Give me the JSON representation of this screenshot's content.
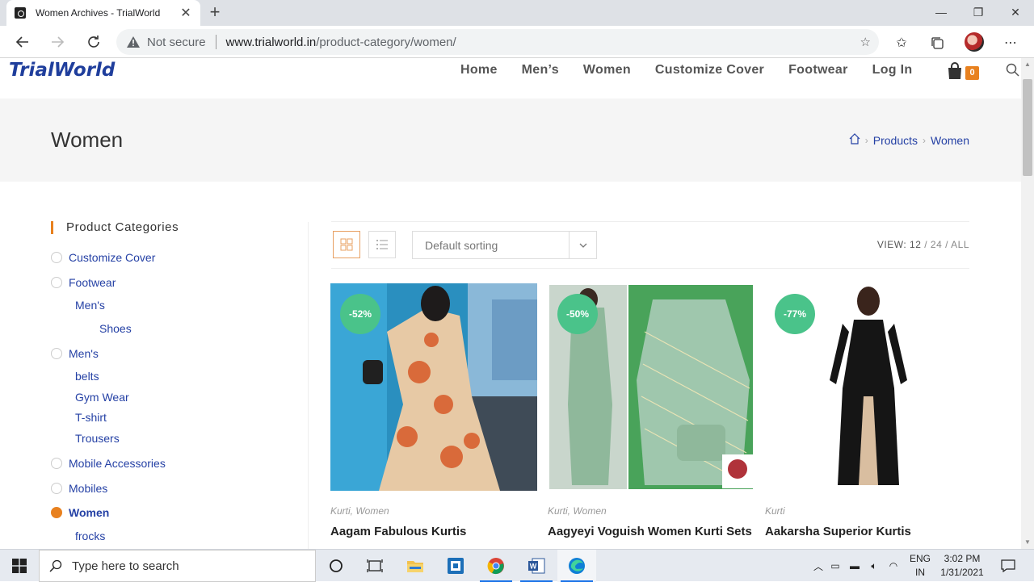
{
  "browser": {
    "tab_title": "Women Archives - TrialWorld",
    "security_label": "Not secure",
    "url_host": "www.trialworld.in",
    "url_path": "/product-category/women/"
  },
  "site": {
    "logo": "TrialWorld",
    "nav": [
      "Home",
      "Men’s",
      "Women",
      "Customize Cover",
      "Footwear",
      "Log In"
    ],
    "cart_count": "0"
  },
  "page": {
    "title": "Women",
    "breadcrumb": [
      "Products",
      "Women"
    ]
  },
  "sidebar": {
    "title": "Product Categories",
    "categories": [
      {
        "label": "Customize Cover",
        "level": 0,
        "active": false
      },
      {
        "label": "Footwear",
        "level": 0,
        "active": false
      },
      {
        "label": "Men's",
        "level": 1,
        "active": false
      },
      {
        "label": "Shoes",
        "level": 2,
        "active": false
      },
      {
        "label": "Men's",
        "level": 0,
        "active": false
      },
      {
        "label": "belts",
        "level": 1,
        "active": false
      },
      {
        "label": "Gym Wear",
        "level": 1,
        "active": false
      },
      {
        "label": "T-shirt",
        "level": 1,
        "active": false
      },
      {
        "label": "Trousers",
        "level": 1,
        "active": false
      },
      {
        "label": "Mobile Accessories",
        "level": 0,
        "active": false
      },
      {
        "label": "Mobiles",
        "level": 0,
        "active": false
      },
      {
        "label": "Women",
        "level": 0,
        "active": true
      },
      {
        "label": "frocks",
        "level": 1,
        "active": false
      }
    ]
  },
  "shop_toolbar": {
    "sort_value": "Default sorting",
    "view_label": "VIEW:",
    "view_options": [
      "12",
      "24",
      "ALL"
    ],
    "view_selected": "12"
  },
  "products": [
    {
      "badge": "-52%",
      "categories": "Kurti, Women",
      "name": "Aagam Fabulous Kurtis"
    },
    {
      "badge": "-50%",
      "categories": "Kurti, Women",
      "name": "Aagyeyi Voguish Women Kurti Sets"
    },
    {
      "badge": "-77%",
      "categories": "Kurti",
      "name": "Aakarsha Superior Kurtis"
    }
  ],
  "taskbar": {
    "search_placeholder": "Type here to search",
    "lang_line1": "ENG",
    "lang_line2": "IN",
    "time": "3:02 PM",
    "date": "1/31/2021"
  },
  "colors": {
    "accent": "#e8811f",
    "link": "#2541a5",
    "logo": "#1f3e9c",
    "sale_badge": "#4ac38a"
  }
}
